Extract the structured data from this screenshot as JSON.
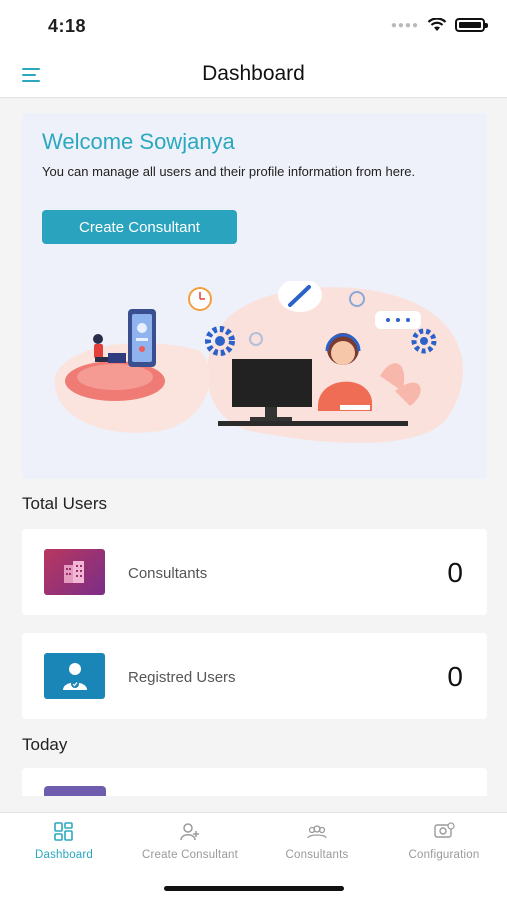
{
  "status_bar": {
    "time": "4:18"
  },
  "header": {
    "title": "Dashboard",
    "menu_icon": "hamburger-icon"
  },
  "welcome": {
    "title": "Welcome Sowjanya",
    "description": "You can manage all users and their profile information from here.",
    "button_label": "Create Consultant"
  },
  "total_users": {
    "title": "Total Users",
    "cards": [
      {
        "label": "Consultants",
        "value": "0",
        "icon": "building-icon",
        "color": "#9a2e6a"
      },
      {
        "label": "Registred Users",
        "value": "0",
        "icon": "user-badge-icon",
        "color": "#1a86b8"
      }
    ]
  },
  "today": {
    "title": "Today"
  },
  "tabs": [
    {
      "label": "Dashboard",
      "icon": "grid-icon",
      "active": true
    },
    {
      "label": "Create Consultant",
      "icon": "add-user-icon",
      "active": false
    },
    {
      "label": "Consultants",
      "icon": "group-icon",
      "active": false
    },
    {
      "label": "Configuration",
      "icon": "config-icon",
      "active": false
    }
  ],
  "colors": {
    "accent": "#2aa8bf",
    "background": "#f4f4f4"
  }
}
